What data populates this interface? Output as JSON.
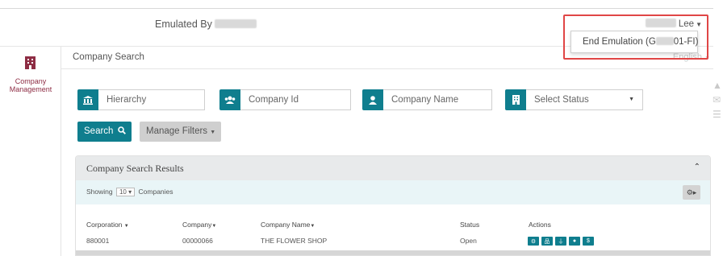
{
  "header": {
    "emulated_label": "Emulated By",
    "user_name_visible": "Lee",
    "dropdown_item": "End Emulation (G",
    "dropdown_item_suffix": "01-FI)"
  },
  "sidebar": {
    "module_label_line1": "Company",
    "module_label_line2": "Management",
    "icon": "building-icon"
  },
  "page": {
    "title": "Company Search",
    "language": "English"
  },
  "filters": [
    {
      "icon": "hierarchy-icon",
      "placeholder": "Hierarchy"
    },
    {
      "icon": "users-icon",
      "placeholder": "Company Id"
    },
    {
      "icon": "person-icon",
      "placeholder": "Company Name"
    },
    {
      "icon": "building-icon",
      "value": "Select Status"
    }
  ],
  "buttons": {
    "search": "Search",
    "manage_filters": "Manage Filters"
  },
  "results": {
    "title": "Company Search Results",
    "showing_prefix": "Showing",
    "page_size": "10",
    "showing_suffix": "Companies",
    "columns": [
      "Corporation",
      "Company",
      "Company Name",
      "Status",
      "Actions"
    ],
    "rows": [
      {
        "corporation": "880001",
        "company": "00000066",
        "company_name": "THE FLOWER SHOP",
        "status": "Open"
      }
    ],
    "action_icons": [
      "gear-icon",
      "sitemap-icon",
      "plug-icon",
      "user-circle-icon",
      "dollar-icon"
    ]
  },
  "colors": {
    "accent": "#0f7e8e",
    "brand": "#8e2d44",
    "highlight": "#e04646"
  }
}
